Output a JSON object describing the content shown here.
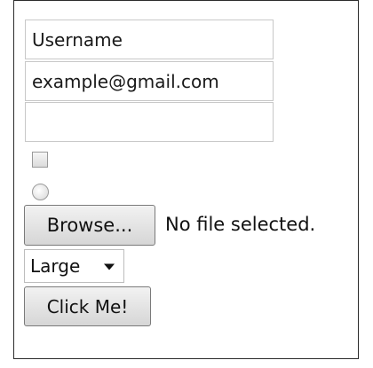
{
  "form": {
    "username_value": "Username",
    "email_value": "example@gmail.com",
    "third_field_value": "",
    "checkbox_checked": false,
    "radio_selected": false,
    "browse_label": "Browse...",
    "file_status": "No file selected.",
    "size_select_value": "Large",
    "click_label": "Click Me!"
  }
}
